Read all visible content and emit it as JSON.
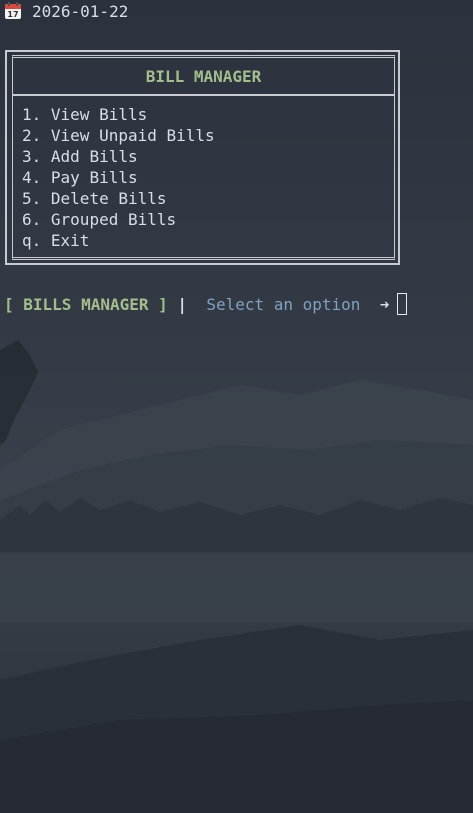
{
  "header": {
    "date": "2026-01-22",
    "calendar_icon": "calendar-icon",
    "calendar_month": "July",
    "calendar_day": "17"
  },
  "menu": {
    "title": "BILL MANAGER",
    "items": [
      {
        "key": "1.",
        "label": "View Bills"
      },
      {
        "key": "2.",
        "label": "View Unpaid Bills"
      },
      {
        "key": "3.",
        "label": "Add Bills"
      },
      {
        "key": "4.",
        "label": "Pay Bills"
      },
      {
        "key": "5.",
        "label": "Delete Bills"
      },
      {
        "key": "6.",
        "label": "Grouped Bills"
      },
      {
        "key": "q.",
        "label": "Exit"
      }
    ]
  },
  "prompt": {
    "tag": "[ BILLS MANAGER ]",
    "separator": "|",
    "text": "Select an option",
    "arrow": "➜",
    "input_value": ""
  },
  "colors": {
    "background": "#2b313c",
    "accent_green": "#a3be8c",
    "accent_blue": "#81a1c1",
    "text": "#d8dee9",
    "border": "#c7cbd1"
  }
}
